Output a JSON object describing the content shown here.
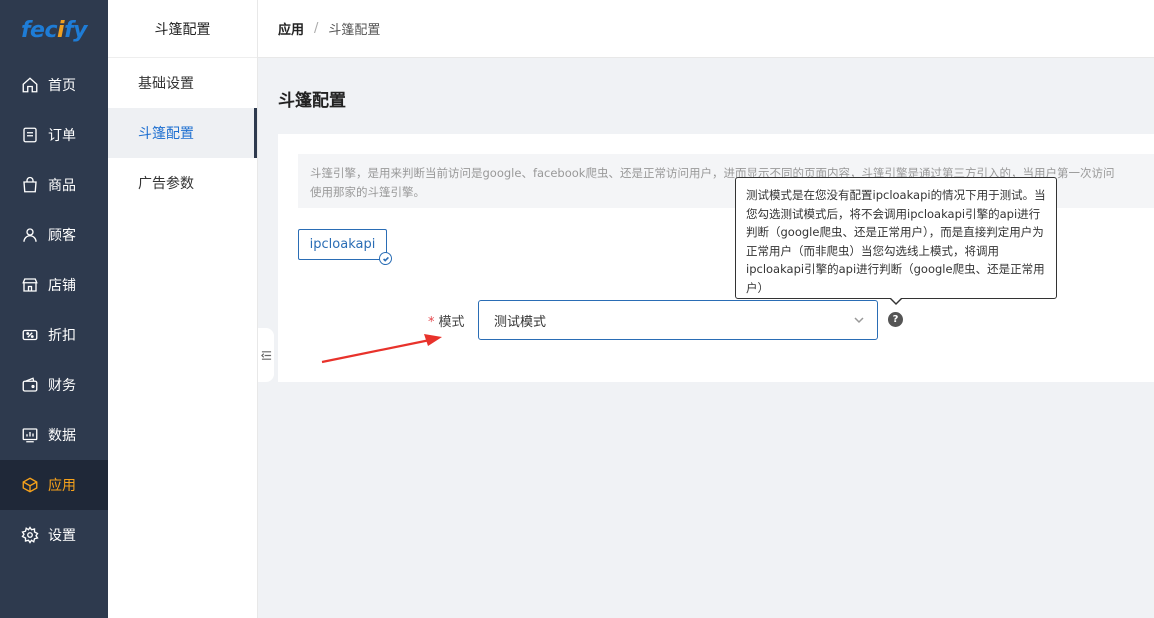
{
  "brand": {
    "logo_text_a": "fec",
    "logo_text_b": "i",
    "logo_text_c": "fy"
  },
  "sidebar": {
    "items": [
      {
        "label": "首页",
        "icon": "home-icon"
      },
      {
        "label": "订单",
        "icon": "order-icon"
      },
      {
        "label": "商品",
        "icon": "shopping-bag-icon"
      },
      {
        "label": "顾客",
        "icon": "user-icon"
      },
      {
        "label": "店铺",
        "icon": "store-icon"
      },
      {
        "label": "折扣",
        "icon": "discount-icon"
      },
      {
        "label": "财务",
        "icon": "wallet-icon"
      },
      {
        "label": "数据",
        "icon": "chart-icon"
      },
      {
        "label": "应用",
        "icon": "box-icon",
        "active": true
      },
      {
        "label": "设置",
        "icon": "gear-icon"
      }
    ],
    "active_color": "#f7a21b"
  },
  "subnav": {
    "title": "斗篷配置",
    "items": [
      {
        "label": "基础设置"
      },
      {
        "label": "斗篷配置",
        "active": true
      },
      {
        "label": "广告参数"
      }
    ]
  },
  "breadcrumb": {
    "root": "应用",
    "separator": "/",
    "current": "斗篷配置"
  },
  "page": {
    "title": "斗篷配置"
  },
  "notice": {
    "line1": "斗篷引擎，是用来判断当前访问是google、facebook爬虫、还是正常访问用户，进而显示不同的页面内容，斗篷引擎是通过第三方引入的，当用户第一次访问",
    "line2": "使用那家的斗篷引擎。"
  },
  "engine_tag": {
    "label": "ipcloakapi"
  },
  "form": {
    "mode_label": "模式",
    "required_mark": "*",
    "mode_value": "测试模式"
  },
  "help": {
    "glyph": "?"
  },
  "tooltip": {
    "text": "测试模式是在您没有配置ipcloakapi的情况下用于测试。当您勾选测试模式后，将不会调用ipcloakapi引擎的api进行判断（google爬虫、还是正常用户），而是直接判定用户为正常用户（而非爬虫）当您勾选线上模式，将调用ipcloakapi引擎的api进行判断（google爬虫、还是正常用户）"
  },
  "colors": {
    "primary": "#2a6db5",
    "sidebar_bg": "#2e3a4e",
    "annotation": "#e8322b"
  }
}
